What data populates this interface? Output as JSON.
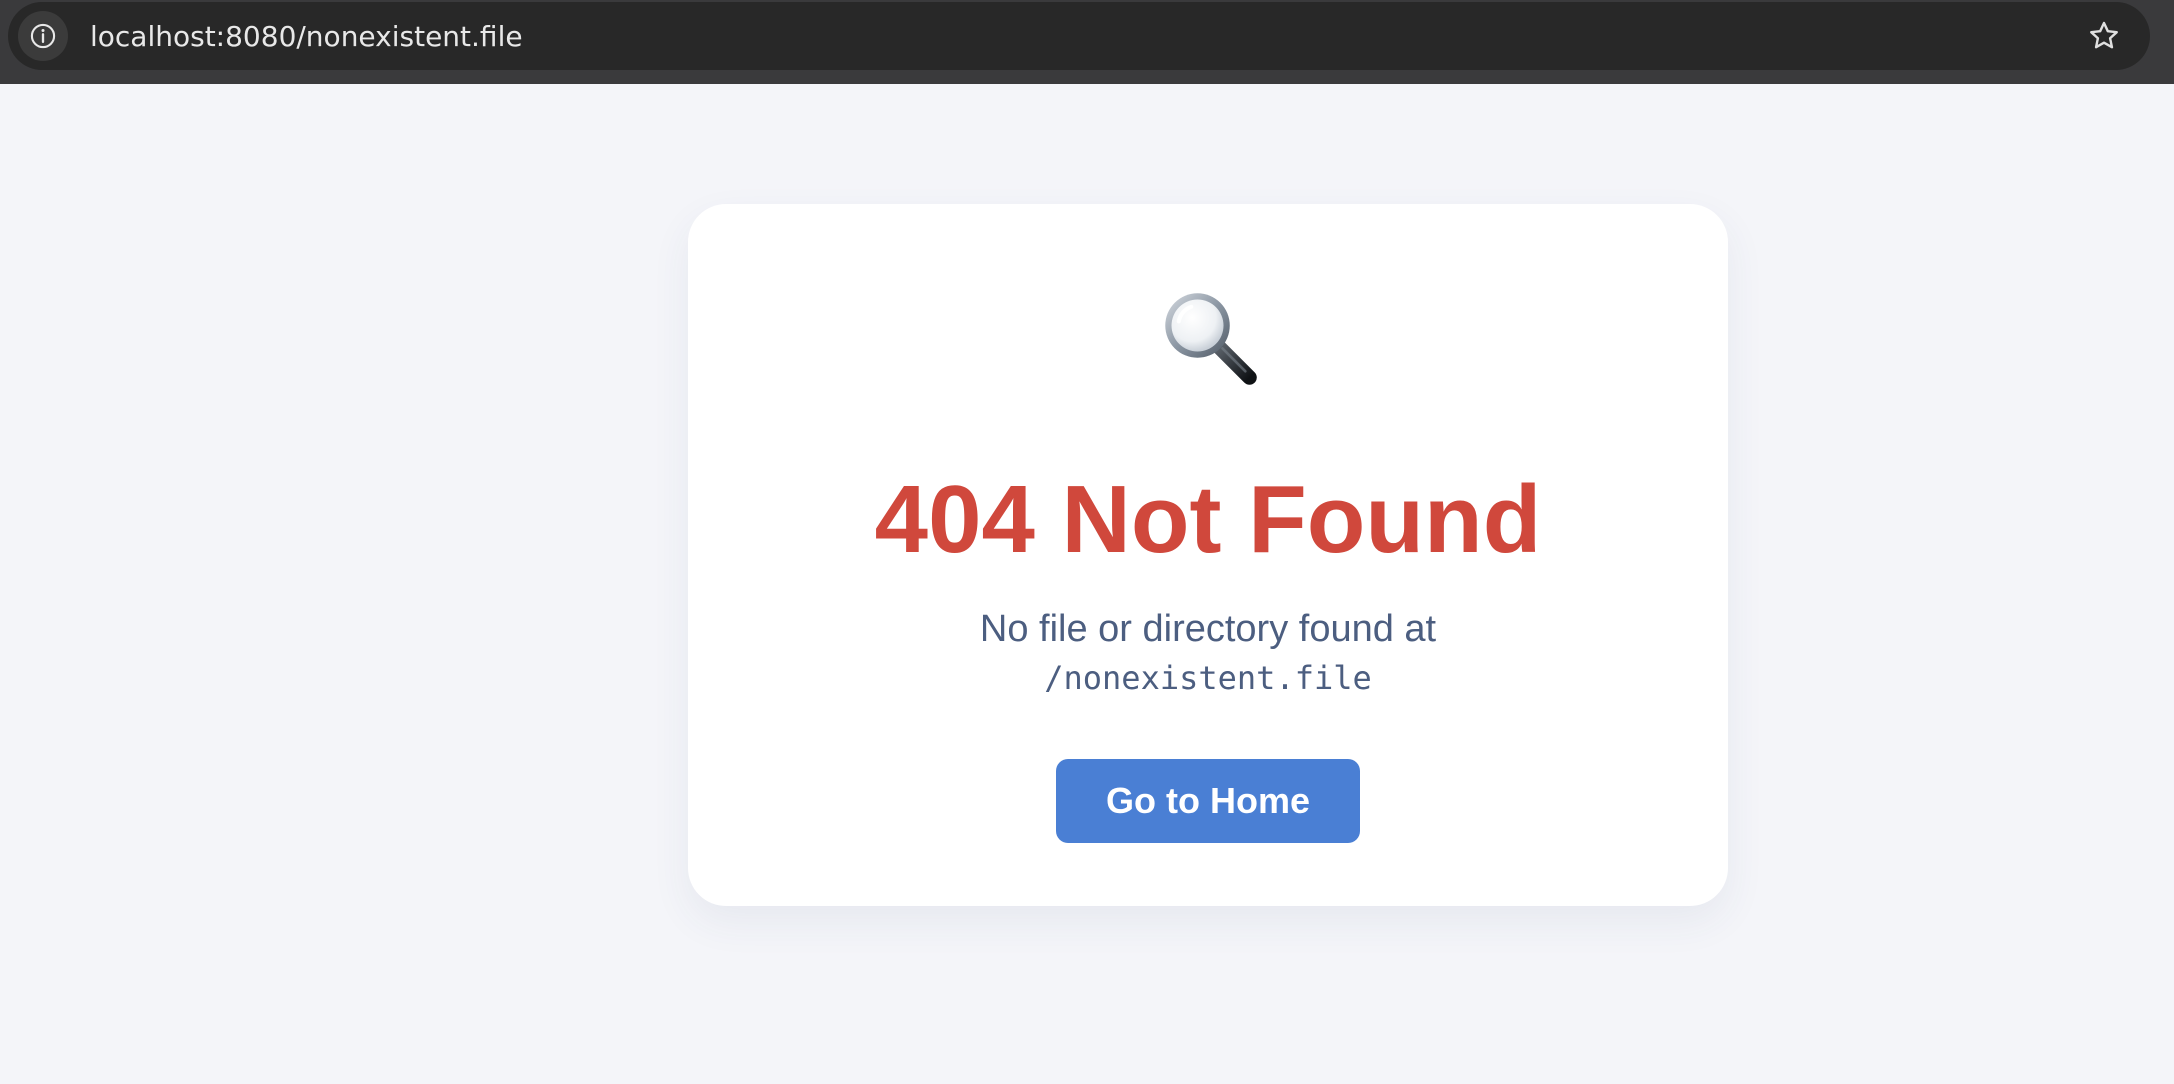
{
  "browser": {
    "url": "localhost:8080/nonexistent.file",
    "info_icon": "info-icon",
    "bookmark_icon": "star-icon"
  },
  "error_card": {
    "icon": "magnifying-glass-icon",
    "title": "404 Not Found",
    "description": "No file or directory found at",
    "path": "/nonexistent.file",
    "button_label": "Go to Home"
  },
  "colors": {
    "title": "#d0483c",
    "text": "#4c5e80",
    "button": "#4a7fd4",
    "page_background": "#f4f5f9"
  }
}
